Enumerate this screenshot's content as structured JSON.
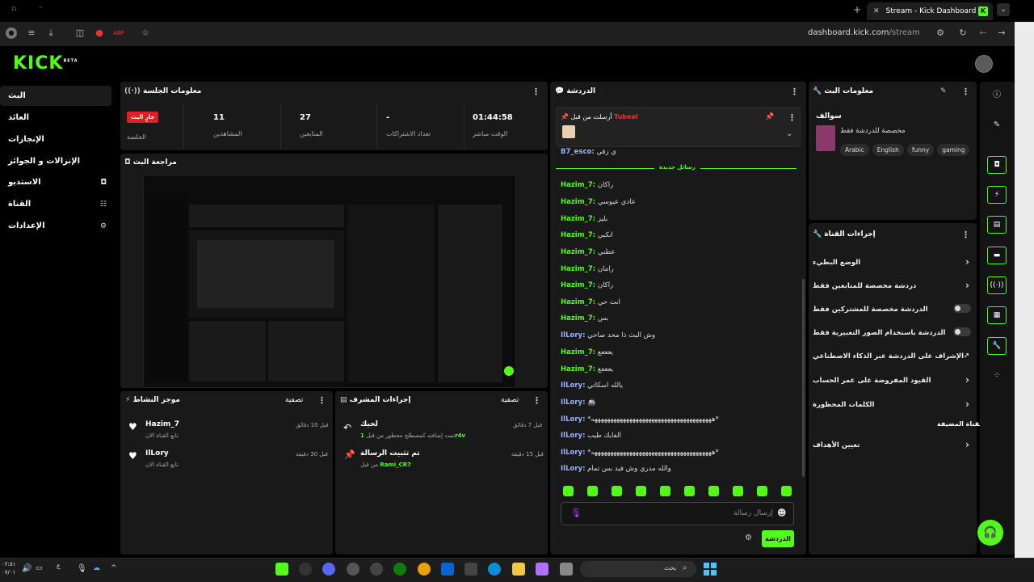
{
  "browser": {
    "tab_title": "Stream - Kick Dashboard",
    "url_domain": "dashboard.kick.com",
    "url_path": "/stream"
  },
  "header": {
    "logo": "KICK",
    "logo_sup": "BETA"
  },
  "nav": {
    "items": [
      {
        "label": "البث"
      },
      {
        "label": "العائد"
      },
      {
        "label": "الإنجازات"
      },
      {
        "label": "الإنزالات و الجوائز"
      },
      {
        "label": "الاستديو"
      },
      {
        "label": "القناة"
      },
      {
        "label": "الإعدادات"
      }
    ]
  },
  "session": {
    "title": "معلومات الجلسة",
    "live_badge": "جارٍ البث",
    "session_label": "الجلسة",
    "viewers_value": "11",
    "viewers_label": "المشاهدين",
    "followers_value": "27",
    "followers_label": "المتابعين",
    "subs_value": "-",
    "subs_label": "تعداد الاشتراكات",
    "live_time_value": "01:44:58",
    "live_time_label": "الوقت مباشر"
  },
  "preview": {
    "title": "مراجعة البث"
  },
  "activity": {
    "title": "موجز النشاط",
    "filter": "تصفية",
    "items": [
      {
        "name": "Hazim_7",
        "sub": "تابع القناة الان",
        "time": "قبل 10 دقائق"
      },
      {
        "name": "IlLory",
        "sub": "تابع القناة الان",
        "time": "قبل 30 دقيقة"
      }
    ]
  },
  "modactions": {
    "title": "إجراءات المشرف",
    "filter": "تصفية",
    "items": [
      {
        "title": "لحيك",
        "sub_user": "1r4v",
        "sub": "تمت إضافته كمصطلح محظور من قبل",
        "time": "قبل 7 دقائق"
      },
      {
        "title": "تم تثبيت الرسالة",
        "sub_user": "Rami_CR7",
        "sub": "من قبل",
        "time": "قبل 15 دقيقة"
      }
    ]
  },
  "chat": {
    "title": "الدردشة",
    "pinned_by_label": "أرسلت من قبل",
    "pinned_by_user": "Tubeal",
    "first_line_user": "B7_esco:",
    "first_line_msg": "ي زقي",
    "new_messages": "رسائل جديدة",
    "lines": [
      {
        "user": "Hazim_7:",
        "msg": "راكان"
      },
      {
        "user": "Hazim_7:",
        "msg": "عادي عيوسي"
      },
      {
        "user": "Hazim_7:",
        "msg": "بليز"
      },
      {
        "user": "Hazim_7:",
        "msg": "انكبي"
      },
      {
        "user": "Hazim_7:",
        "msg": "عطني"
      },
      {
        "user": "Hazim_7:",
        "msg": "رامان"
      },
      {
        "user": "Hazim_7:",
        "msg": "راكان"
      },
      {
        "user": "Hazim_7:",
        "msg": "انت حي"
      },
      {
        "user": "Hazim_7:",
        "msg": "بس"
      },
      {
        "user": "IlLory:",
        "msg": "وش البث ذا محد صاحي"
      },
      {
        "user": "Hazim_7:",
        "msg": "يعععع"
      },
      {
        "user": "Hazim_7:",
        "msg": "يعععع"
      },
      {
        "user": "IlLory:",
        "msg": "يالله اسكاتي"
      },
      {
        "user": "IlLory:",
        "msg": "🚢"
      },
      {
        "user": "IlLory:",
        "msg": "*ههههههههههههههههههههههههههههههههههههههه*"
      },
      {
        "user": "IlLory:",
        "msg": "الفايك طيب"
      },
      {
        "user": "IlLory:",
        "msg": "*ههههههههههههههههههههههههههههههههههههههه*"
      },
      {
        "user": "IlLory:",
        "msg": "والله مدري وش فيد بس تمام"
      }
    ],
    "input_placeholder": "إرسال رسالة",
    "send_button": "الدردشة"
  },
  "streaminfo": {
    "title": "معلومات البث",
    "category": "سوالف",
    "stream_title": "مخصصة للدردشة فقط",
    "tags": [
      "Arabic",
      "English",
      "funny",
      "gaming"
    ]
  },
  "channelactions": {
    "title": "إجراءات القناة",
    "rows": [
      {
        "label": "الوضع البطيء",
        "control": "chevron"
      },
      {
        "label": "دردشة مخصصة للمتابعين فقط",
        "control": "chevron"
      },
      {
        "label": "الدردشة مخصصة للمشتركين فقط",
        "control": "toggle"
      },
      {
        "label": "الدردشة باستخدام الصور التعبيرية فقط",
        "control": "toggle"
      },
      {
        "label": "الإشراف على الدردشة عبر الذكاء الاصطناعي",
        "control": "external"
      },
      {
        "label": "القيود المفروضة على عمر الحساب",
        "control": "chevron"
      },
      {
        "label": "الكلمات المحظورة",
        "control": "chevron"
      }
    ],
    "section_label": "القناة المضيفة",
    "last_row": "تعيين الأهداف"
  },
  "taskbar": {
    "search_placeholder": "بحث",
    "time": "٠٢:٥١",
    "date": "٠٧/٠١",
    "lang": "ع"
  },
  "colors": {
    "accent": "#53fc18",
    "panel": "#191919",
    "live": "#e02020"
  }
}
